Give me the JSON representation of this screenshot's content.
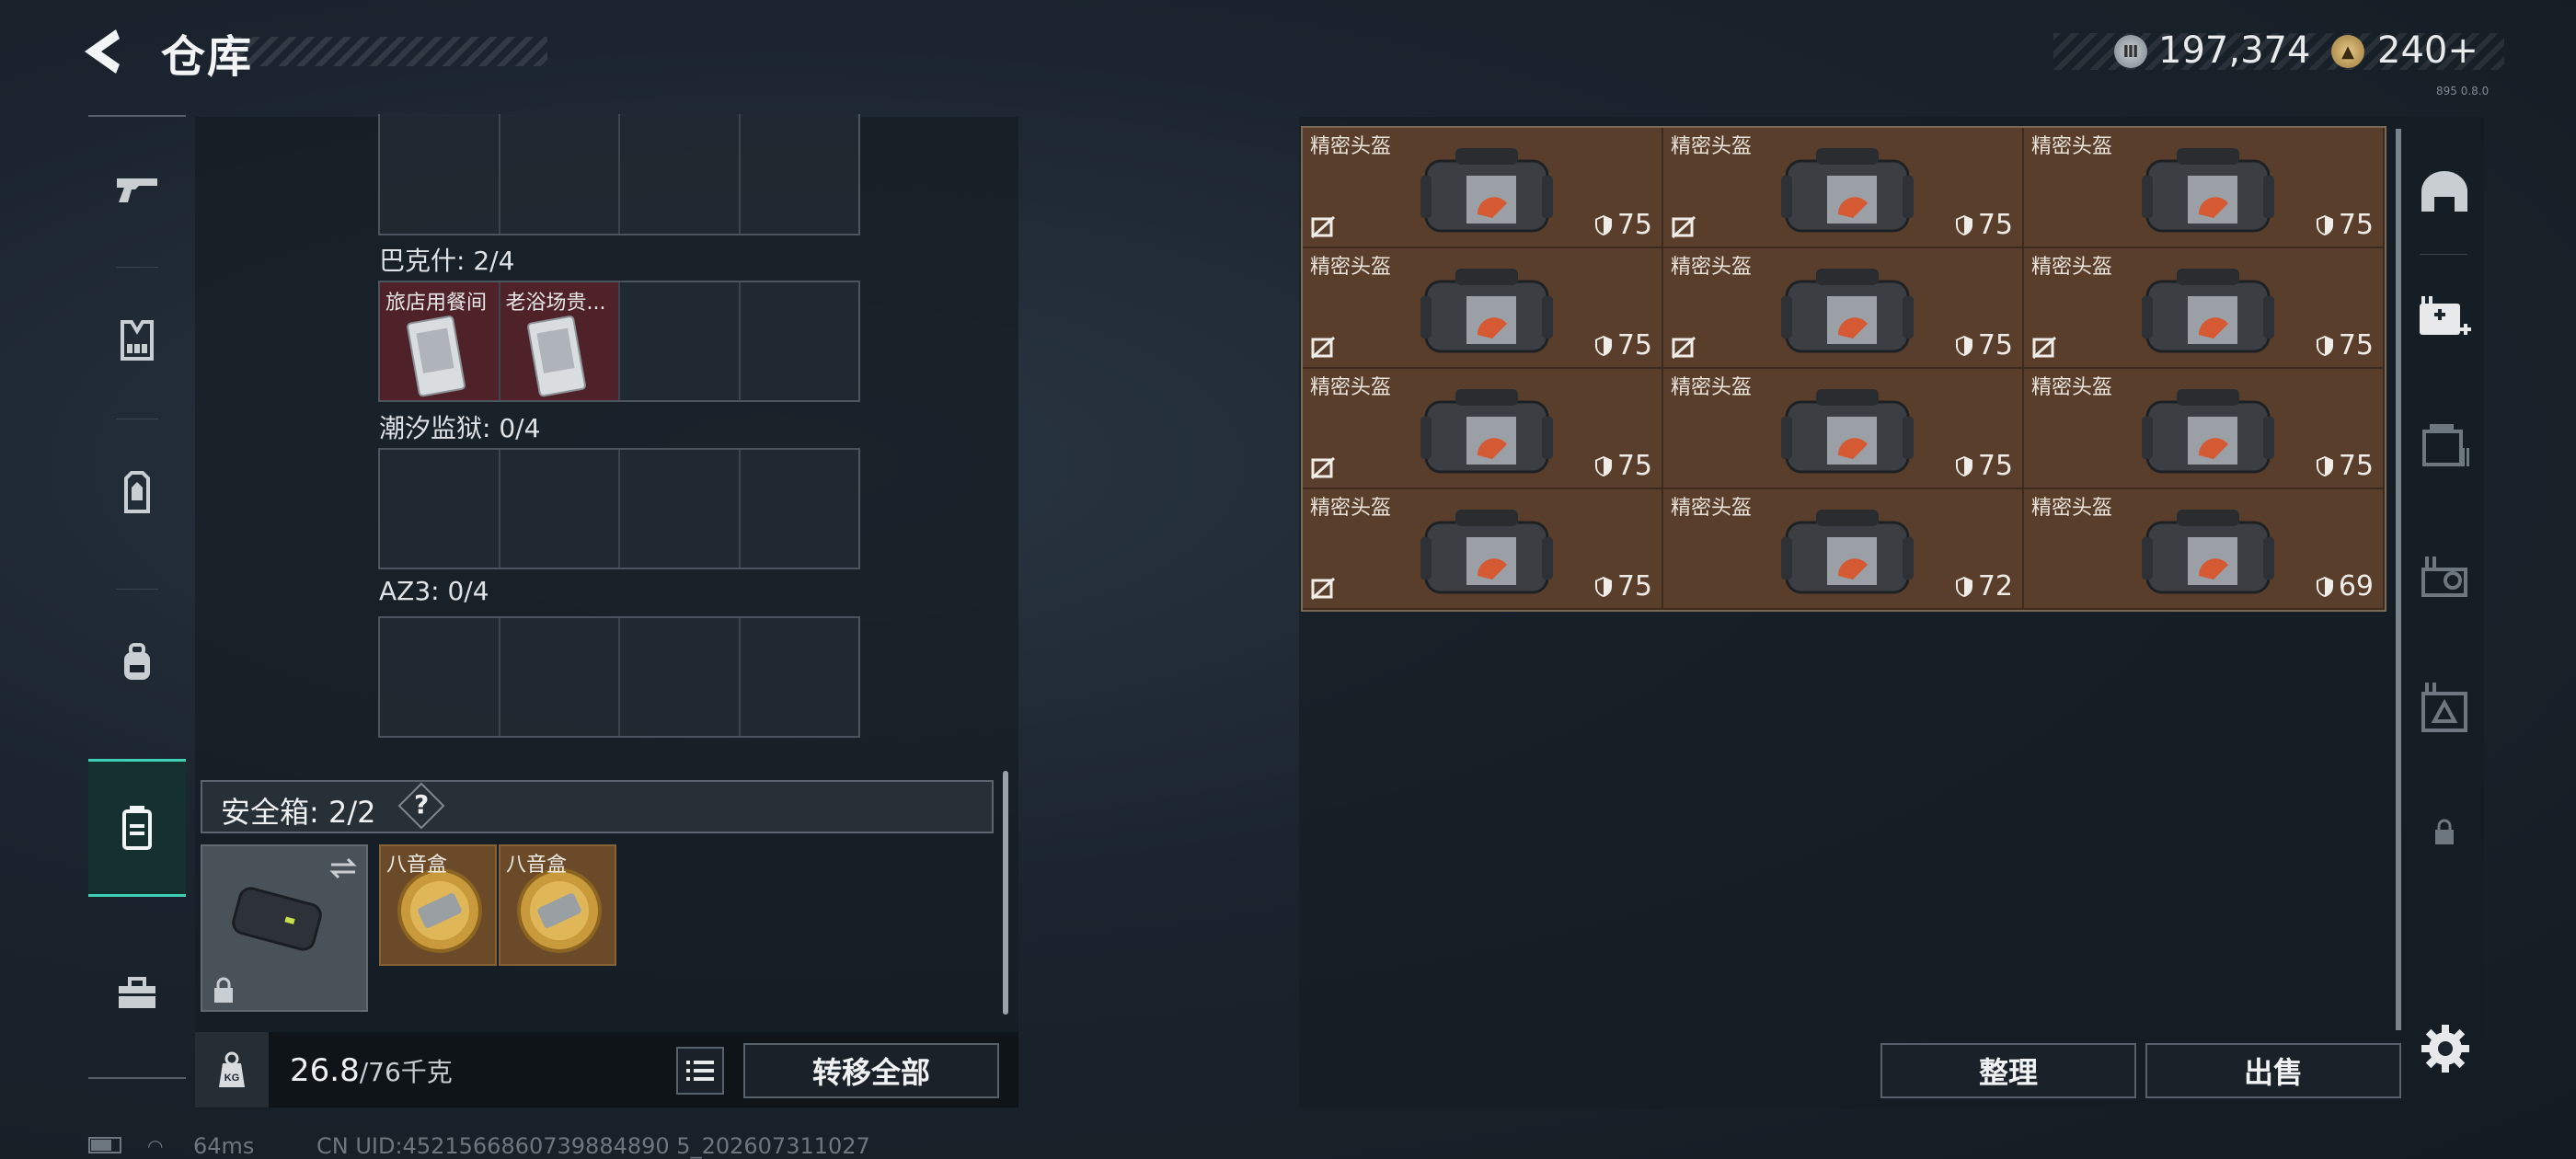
{
  "header": {
    "title": "仓库",
    "currency1": "197,374",
    "currency2": "240+",
    "version": "895 0.8.0"
  },
  "left_sidebar": {
    "items": [
      "pistol-icon",
      "vest-icon",
      "backpack-armor-icon",
      "backpack-icon",
      "safebox-icon",
      "toolbox-icon"
    ],
    "active_index": 4
  },
  "containers": [
    {
      "label": "",
      "slots": [
        "",
        "",
        "",
        ""
      ]
    },
    {
      "label": "巴克什: 2/4",
      "slots": [
        "旅店用餐间",
        "老浴场贵...",
        "",
        ""
      ]
    },
    {
      "label": "潮汐监狱: 0/4",
      "slots": [
        "",
        "",
        "",
        ""
      ]
    },
    {
      "label": "AZ3: 0/4",
      "slots": [
        "",
        "",
        "",
        ""
      ]
    }
  ],
  "safebox": {
    "title": "安全箱: 2/2",
    "help": "?",
    "items": [
      "八音盒",
      "八音盒"
    ]
  },
  "weight": {
    "kg_label": "KG",
    "current": "26.8",
    "max": "/76千克"
  },
  "buttons": {
    "transfer_all": "转移全部",
    "sort": "整理",
    "sell": "出售"
  },
  "status": {
    "ping": "64ms",
    "uid": "CN UID:4521566860739884890 5_202607311027"
  },
  "right_items": [
    {
      "name": "精密头盔",
      "value": "75",
      "notrade": true
    },
    {
      "name": "精密头盔",
      "value": "75",
      "notrade": true
    },
    {
      "name": "精密头盔",
      "value": "75",
      "notrade": false
    },
    {
      "name": "精密头盔",
      "value": "75",
      "notrade": true
    },
    {
      "name": "精密头盔",
      "value": "75",
      "notrade": true
    },
    {
      "name": "精密头盔",
      "value": "75",
      "notrade": true
    },
    {
      "name": "精密头盔",
      "value": "75",
      "notrade": true
    },
    {
      "name": "精密头盔",
      "value": "75",
      "notrade": false
    },
    {
      "name": "精密头盔",
      "value": "75",
      "notrade": false
    },
    {
      "name": "精密头盔",
      "value": "75",
      "notrade": true
    },
    {
      "name": "精密头盔",
      "value": "72",
      "notrade": false
    },
    {
      "name": "精密头盔",
      "value": "69",
      "notrade": false
    }
  ],
  "right_tools": [
    "dome-icon",
    "medkit-add-icon",
    "locker-icon",
    "workbench-icon",
    "blueprint-icon",
    "lock-icon"
  ],
  "colors": {
    "accent": "#3fd1b3",
    "item_bg": "#5a3e2c",
    "red_slot": "#4e2228",
    "gold_slot": "#6b4a2a"
  }
}
